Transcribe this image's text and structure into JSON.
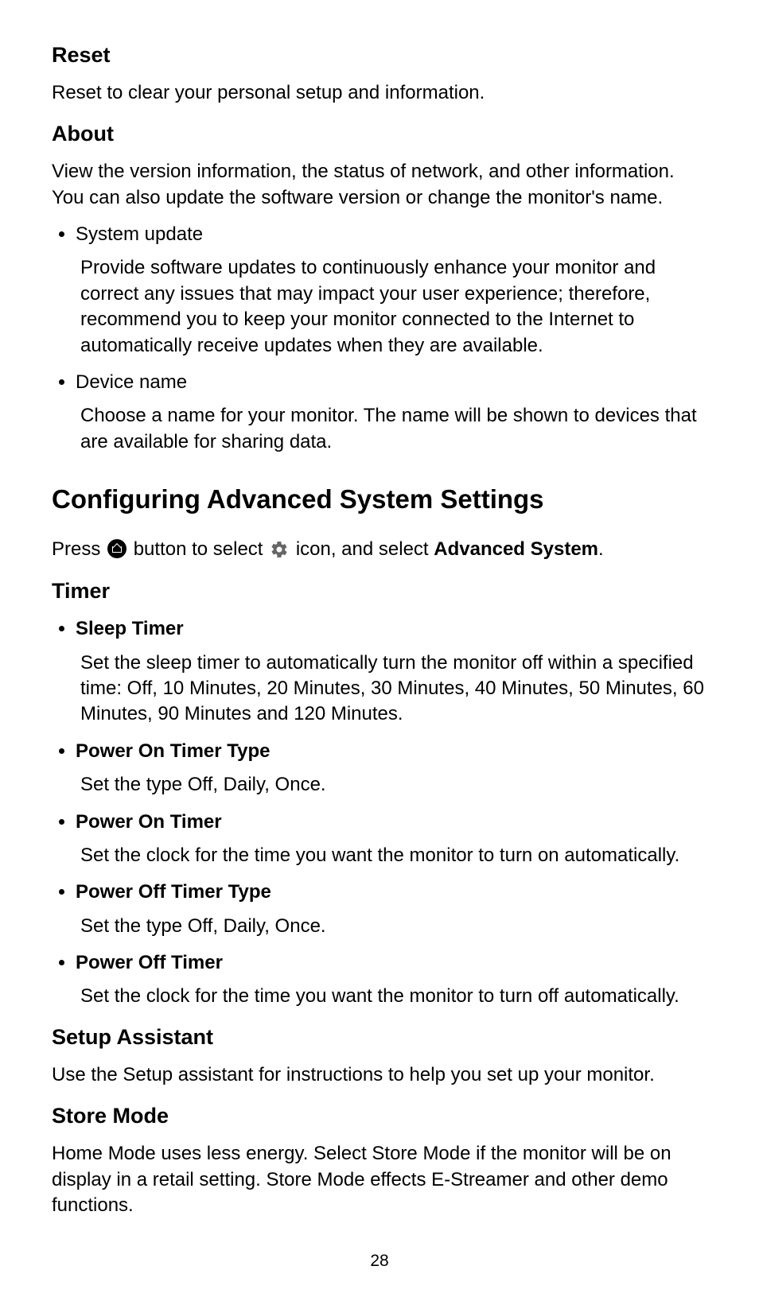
{
  "reset": {
    "heading": "Reset",
    "body": "Reset to clear your personal setup and information."
  },
  "about": {
    "heading": "About",
    "body": "View the version information, the status of network, and other information. You can also update the software version or change the monitor's name.",
    "items": [
      {
        "label": "System update",
        "desc": "Provide software updates to continuously enhance your monitor and correct any issues that may impact your user experience; therefore, recommend you to keep your monitor connected to the Internet to automatically receive updates when they are available."
      },
      {
        "label": "Device name",
        "desc": "Choose a name for your monitor. The name will be shown to devices that are available for sharing data."
      }
    ]
  },
  "config": {
    "heading": "Configuring Advanced System Settings",
    "press1": "Press ",
    "press2": " button to select ",
    "press3": " icon, and select ",
    "press4_bold": "Advanced System",
    "press5": "."
  },
  "timer": {
    "heading": "Timer",
    "items": [
      {
        "label": "Sleep Timer",
        "desc": "Set the sleep timer to automatically turn the monitor off within a specified time: Off, 10 Minutes, 20 Minutes, 30 Minutes, 40 Minutes, 50 Minutes, 60 Minutes, 90 Minutes and 120 Minutes."
      },
      {
        "label": "Power On Timer Type",
        "desc": "Set the type Off, Daily, Once."
      },
      {
        "label": "Power On Timer",
        "desc": "Set the clock for the time you want the monitor to turn on automatically."
      },
      {
        "label": "Power Off Timer Type",
        "desc": "Set the type Off, Daily, Once."
      },
      {
        "label": "Power Off Timer",
        "desc": "Set the clock for the time you want the monitor to turn off automatically."
      }
    ]
  },
  "setup": {
    "heading": "Setup Assistant",
    "body": "Use the Setup assistant for instructions to help you set up your monitor."
  },
  "store": {
    "heading": "Store Mode",
    "body": "Home Mode uses less energy. Select Store Mode if the monitor will be on display in a retail setting. Store Mode effects E-Streamer and other demo functions."
  },
  "page_number": "28"
}
